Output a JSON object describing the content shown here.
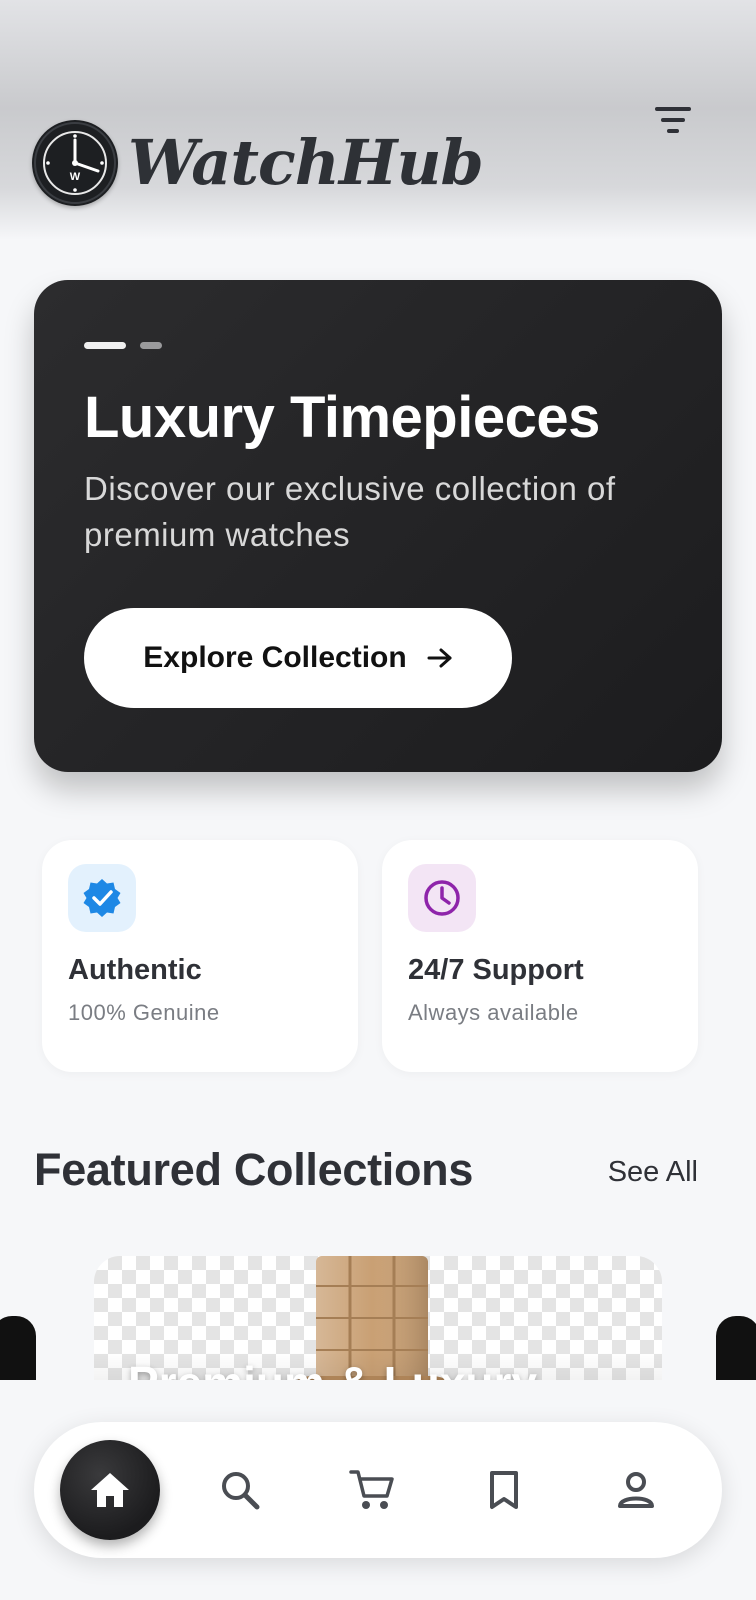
{
  "header": {
    "brand_name": "WatchHub",
    "brand_logo_letter": "W"
  },
  "hero": {
    "title": "Luxury Timepieces",
    "subtitle": "Discover our exclusive collection of premium watches",
    "cta_label": "Explore Collection",
    "slides": 2,
    "active_slide": 1
  },
  "features": [
    {
      "title": "Authentic",
      "subtitle": "100% Genuine",
      "icon": "verified-badge-icon",
      "icon_color": "#1e88e5",
      "icon_bg": "#e3f1fd"
    },
    {
      "title": "24/7 Support",
      "subtitle": "Always available",
      "icon": "clock-icon",
      "icon_color": "#8e24aa",
      "icon_bg": "#f3e5f5"
    }
  ],
  "featured": {
    "section_title": "Featured Collections",
    "see_all_label": "See All",
    "cards": [
      {
        "title": "Premium & Luxury"
      }
    ]
  },
  "bottom_nav": {
    "items": [
      {
        "icon": "home-icon",
        "active": true
      },
      {
        "icon": "search-icon",
        "active": false
      },
      {
        "icon": "cart-icon",
        "active": false
      },
      {
        "icon": "bookmark-icon",
        "active": false
      },
      {
        "icon": "profile-icon",
        "active": false
      }
    ]
  },
  "colors": {
    "hero_bg": "#242426",
    "text_dark": "#2f3137",
    "text_muted": "#7a7d83",
    "nav_active": "#1c1c1e"
  }
}
